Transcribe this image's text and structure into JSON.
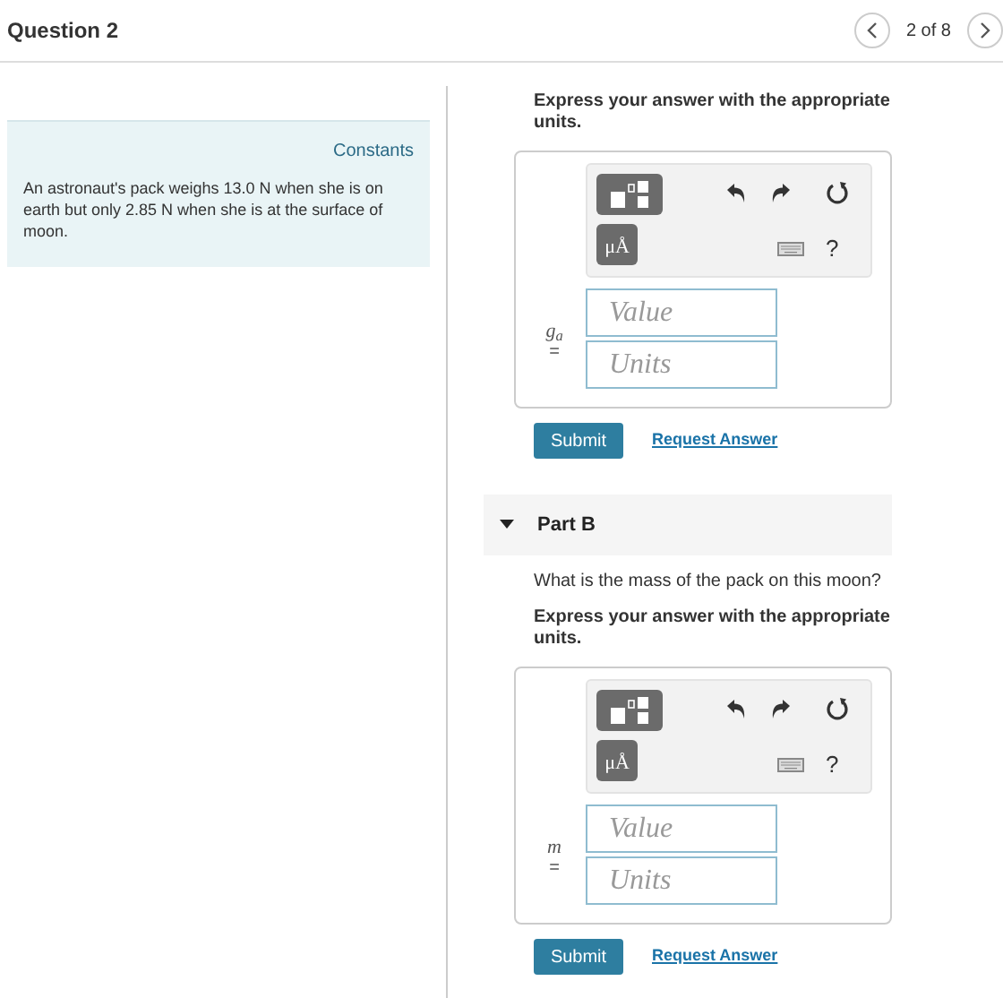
{
  "header": {
    "title": "Question 2",
    "position": "2 of 8"
  },
  "constants": {
    "link": "Constants",
    "text": "An astronaut's pack weighs 13.0  N when she is on earth but only 2.85  N when she is at the surface of moon."
  },
  "parts": [
    {
      "instruction": "Express your answer with the appropriate units.",
      "units_button": "μÅ",
      "help": "?",
      "variable": "g$_{a}$",
      "equals": "=",
      "value_placeholder": "Value",
      "units_placeholder": "Units",
      "submit": "Submit",
      "request": "Request Answer"
    },
    {
      "header": {
        "title": "Part B",
        "expanded": true
      },
      "question": "What is the mass of the pack on this moon?",
      "instruction": "Express your answer with the appropriate units.",
      "units_button": "μÅ",
      "help": "?",
      "variable": "m",
      "equals": "=",
      "value_placeholder": "Value",
      "units_placeholder": "Units",
      "submit": "Submit",
      "request": "Request Answer"
    }
  ]
}
